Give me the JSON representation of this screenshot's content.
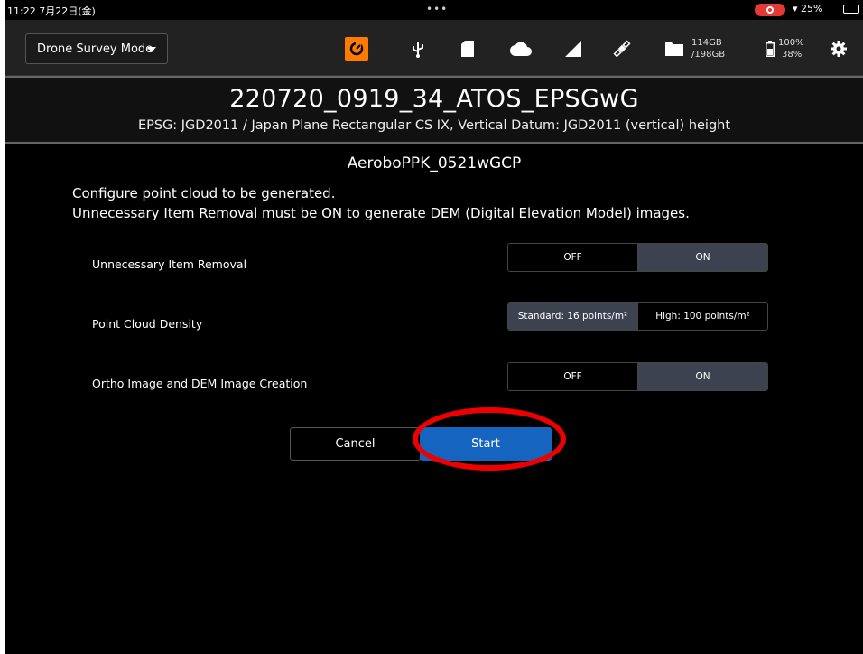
{
  "status_bar": {
    "time": "11:22  7月22日(金)",
    "dots": "•••",
    "battery_pct": "25%",
    "battery_level": 0.25
  },
  "toolbar": {
    "mode_label": "Drone Survey Mode",
    "storage_used": "114GB",
    "storage_total": "/198GB",
    "power_top": "100%",
    "power_bottom": "38%",
    "icons": [
      "app-logo-icon",
      "usb-icon",
      "sd-card-icon",
      "cloud-icon",
      "signal-icon",
      "satellite-icon",
      "folder-icon",
      "battery-icon",
      "gear-icon"
    ],
    "accent_color": "#ff7a00"
  },
  "header": {
    "title": "220720_0919_34_ATOS_EPSGwG",
    "epsg": "EPSG: JGD2011 / Japan Plane Rectangular CS IX, Vertical Datum: JGD2011 (vertical) height"
  },
  "content": {
    "dataset": "AeroboPPK_0521wGCP",
    "desc_line1": "Configure point cloud to be generated.",
    "desc_line2": "Unnecessary Item Removal must be ON to generate DEM (Digital Elevation Model) images.",
    "options": [
      {
        "label": "Unnecessary Item Removal",
        "choices": [
          "OFF",
          "ON"
        ],
        "selected": "ON"
      },
      {
        "label": "Point Cloud Density",
        "choices": [
          "Standard: 16 points/m²",
          "High: 100 points/m²"
        ],
        "selected": "Standard: 16 points/m²"
      },
      {
        "label": "Ortho Image and DEM Image Creation",
        "choices": [
          "OFF",
          "ON"
        ],
        "selected": "ON"
      }
    ],
    "cancel_label": "Cancel",
    "start_label": "Start",
    "start_color": "#1565c0",
    "highlight_color": "#e00000"
  }
}
